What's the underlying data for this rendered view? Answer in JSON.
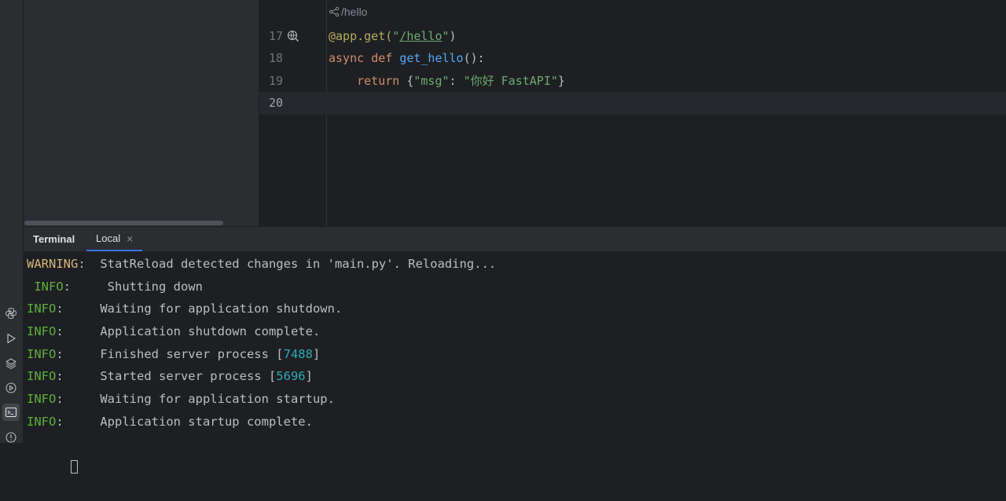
{
  "editor": {
    "inlay_hint": "/hello",
    "lines": [
      {
        "num": "17",
        "tokens": [
          {
            "t": "@app.get(",
            "c": "tk-deco"
          },
          {
            "t": "\"",
            "c": "tk-str"
          },
          {
            "t": "/hello",
            "c": "tk-url"
          },
          {
            "t": "\"",
            "c": "tk-str"
          },
          {
            "t": ")",
            "c": ""
          }
        ]
      },
      {
        "num": "18",
        "tokens": [
          {
            "t": "async ",
            "c": "tk-kw"
          },
          {
            "t": "def ",
            "c": "tk-kw"
          },
          {
            "t": "get_hello",
            "c": "tk-fn"
          },
          {
            "t": "():",
            "c": ""
          }
        ]
      },
      {
        "num": "19",
        "tokens": [
          {
            "t": "    ",
            "c": ""
          },
          {
            "t": "return ",
            "c": "tk-kw"
          },
          {
            "t": "{",
            "c": ""
          },
          {
            "t": "\"msg\"",
            "c": "tk-str"
          },
          {
            "t": ": ",
            "c": ""
          },
          {
            "t": "\"你好 FastAPI\"",
            "c": "tk-str"
          },
          {
            "t": "}",
            "c": ""
          }
        ]
      },
      {
        "num": "20",
        "tokens": []
      }
    ]
  },
  "terminal": {
    "title": "Terminal",
    "tab_label": "Local",
    "tab_close": "×",
    "lines": [
      {
        "level": "WARNING",
        "level_class": "lv-warn",
        "sep": ":  ",
        "message": "StatReload detected changes in 'main.py'. Reloading...",
        "pid": "",
        "suffix": ""
      },
      {
        "level": " INFO",
        "level_class": "lv-info",
        "sep": ":     ",
        "message": "Shutting down",
        "pid": "",
        "suffix": ""
      },
      {
        "level": "INFO",
        "level_class": "lv-info",
        "sep": ":     ",
        "message": "Waiting for application shutdown.",
        "pid": "",
        "suffix": ""
      },
      {
        "level": "INFO",
        "level_class": "lv-info",
        "sep": ":     ",
        "message": "Application shutdown complete.",
        "pid": "",
        "suffix": ""
      },
      {
        "level": "INFO",
        "level_class": "lv-info",
        "sep": ":     ",
        "message": "Finished server process [",
        "pid": "7488",
        "suffix": "]"
      },
      {
        "level": "INFO",
        "level_class": "lv-info",
        "sep": ":     ",
        "message": "Started server process [",
        "pid": "5696",
        "suffix": "]"
      },
      {
        "level": "INFO",
        "level_class": "lv-info",
        "sep": ":     ",
        "message": "Waiting for application startup.",
        "pid": "",
        "suffix": ""
      },
      {
        "level": "INFO",
        "level_class": "lv-info",
        "sep": ":     ",
        "message": "Application startup complete.",
        "pid": "",
        "suffix": ""
      }
    ]
  },
  "toolbar": {
    "icons": [
      "python-console-icon",
      "run-icon",
      "layers-icon",
      "services-icon",
      "terminal-icon",
      "problems-icon"
    ],
    "active": "terminal-icon"
  },
  "colors": {
    "background": "#1e1f22",
    "panel": "#2b2d30",
    "accent": "#3574f0",
    "info": "#5fb03c",
    "warning": "#d5b778"
  }
}
